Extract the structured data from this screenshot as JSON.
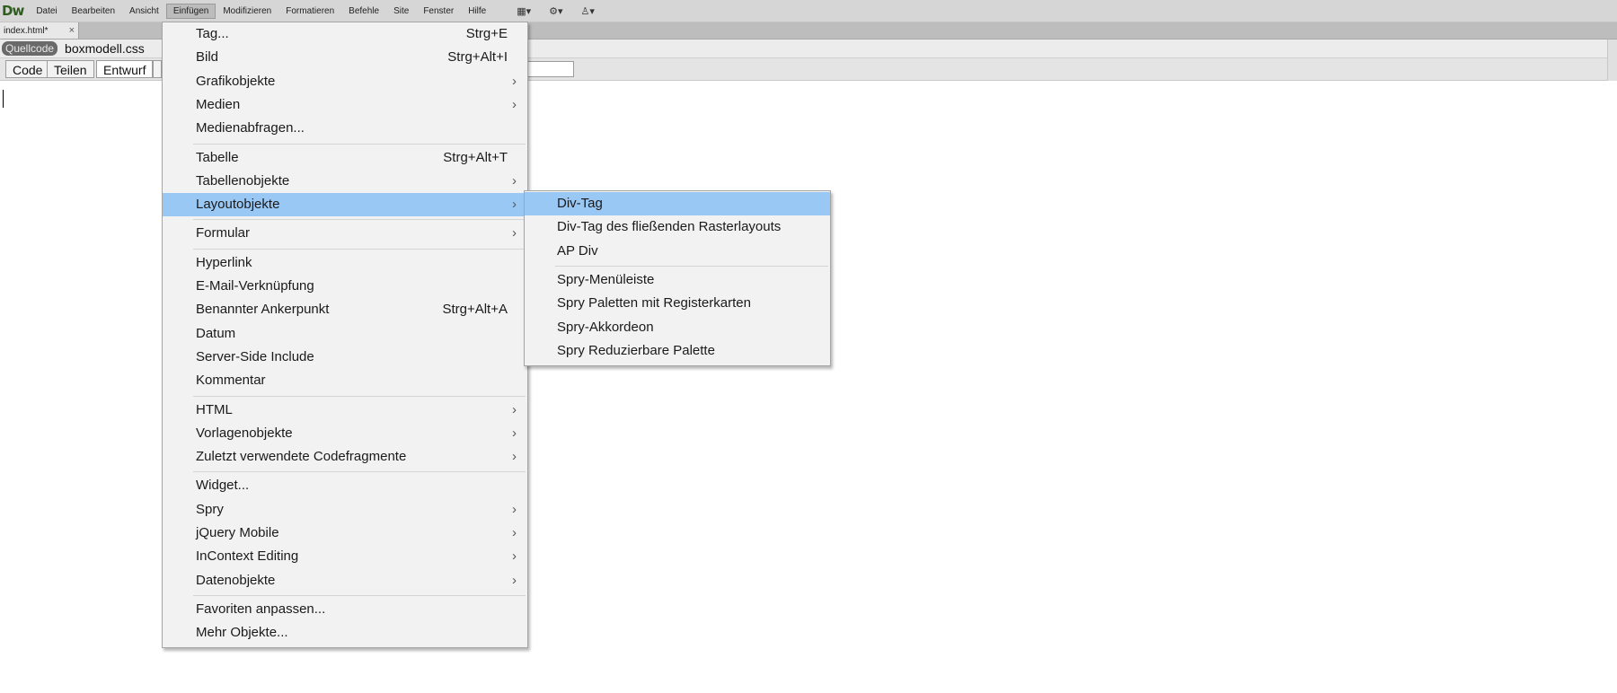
{
  "app": {
    "logo": "Dw"
  },
  "menubar": {
    "items": [
      "Datei",
      "Bearbeiten",
      "Ansicht",
      "Einfügen",
      "Modifizieren",
      "Formatieren",
      "Befehle",
      "Site",
      "Fenster",
      "Hilfe"
    ],
    "active": "Einfügen",
    "tools": [
      {
        "icon": "layout-icon",
        "glyph": "▦▾"
      },
      {
        "icon": "gear-icon",
        "glyph": "⚙▾"
      },
      {
        "icon": "user-icon",
        "glyph": "♙▾"
      }
    ]
  },
  "tab": {
    "name": "index.html*",
    "close": "×"
  },
  "related": {
    "source": "Quellcode",
    "file": "boxmodell.css"
  },
  "views": [
    "Code",
    "Teilen",
    "Entwurf"
  ],
  "active_view": "Entwurf",
  "menu": {
    "items": [
      {
        "label": "Tag...",
        "shortcut": "Strg+E"
      },
      {
        "label": "Bild",
        "shortcut": "Strg+Alt+I"
      },
      {
        "label": "Grafikobjekte",
        "submenu": true
      },
      {
        "label": "Medien",
        "submenu": true
      },
      {
        "label": "Medienabfragen..."
      },
      {
        "label": "Tabelle",
        "shortcut": "Strg+Alt+T",
        "sep_before": true
      },
      {
        "label": "Tabellenobjekte",
        "submenu": true
      },
      {
        "label": "Layoutobjekte",
        "submenu": true,
        "highlighted": true
      },
      {
        "label": "Formular",
        "submenu": true,
        "sep_before": true
      },
      {
        "label": "Hyperlink",
        "sep_before": true
      },
      {
        "label": "E-Mail-Verknüpfung"
      },
      {
        "label": "Benannter Ankerpunkt",
        "shortcut": "Strg+Alt+A"
      },
      {
        "label": "Datum"
      },
      {
        "label": "Server-Side Include"
      },
      {
        "label": "Kommentar"
      },
      {
        "label": "HTML",
        "submenu": true,
        "sep_before": true
      },
      {
        "label": "Vorlagenobjekte",
        "submenu": true
      },
      {
        "label": "Zuletzt verwendete Codefragmente",
        "submenu": true
      },
      {
        "label": "Widget...",
        "sep_before": true
      },
      {
        "label": "Spry",
        "submenu": true
      },
      {
        "label": "jQuery Mobile",
        "submenu": true
      },
      {
        "label": "InContext Editing",
        "submenu": true
      },
      {
        "label": "Datenobjekte",
        "submenu": true
      },
      {
        "label": "Favoriten anpassen...",
        "sep_before": true
      },
      {
        "label": "Mehr Objekte..."
      }
    ]
  },
  "submenu": {
    "items": [
      {
        "label": "Div-Tag",
        "highlighted": true
      },
      {
        "label": "Div-Tag des fließenden Rasterlayouts"
      },
      {
        "label": "AP Div"
      },
      {
        "label": "Spry-Menüleiste",
        "sep_before": true
      },
      {
        "label": "Spry Paletten mit Registerkarten"
      },
      {
        "label": "Spry-Akkordeon"
      },
      {
        "label": "Spry Reduzierbare Palette"
      }
    ]
  },
  "colors": {
    "highlight": "#99c8f5",
    "menu_bg": "#f2f2f2",
    "menubar_bg": "#d6d6d6"
  }
}
